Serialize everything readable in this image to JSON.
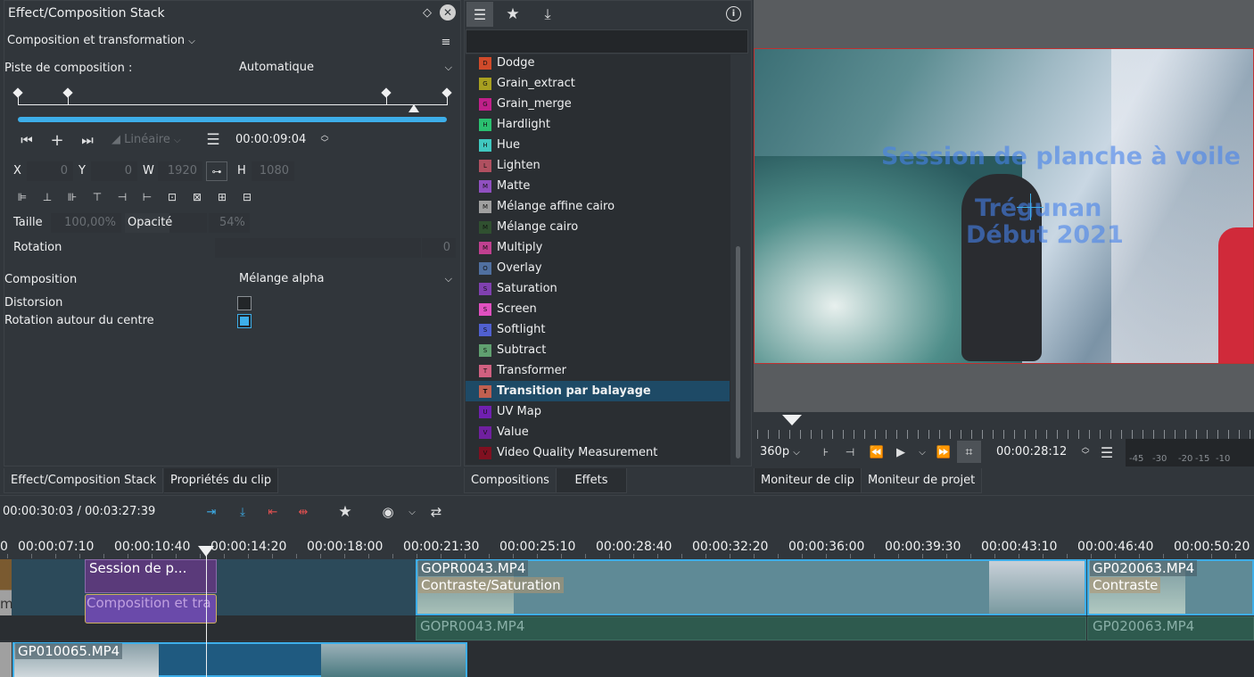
{
  "effect_panel": {
    "title": "Effect/Composition Stack",
    "section": "Composition et transformation",
    "track_label": "Piste de composition :",
    "track_value": "Automatique",
    "interp": "Linéaire",
    "timecode": "00:00:09:04",
    "x_label": "X",
    "x_value": "0",
    "y_label": "Y",
    "y_value": "0",
    "w_label": "W",
    "w_value": "1920",
    "h_label": "H",
    "h_value": "1080",
    "size_label": "Taille",
    "size_value": "100,00%",
    "opacity_label": "Opacité",
    "opacity_value": "54%",
    "rotation_label": "Rotation",
    "rotation_value": "0",
    "composition_label": "Composition",
    "composition_value": "Mélange alpha",
    "distortion_label": "Distorsion",
    "rotate_center_label": "Rotation autour du centre",
    "distortion_checked": false,
    "rotate_center_checked": true
  },
  "left_tabs": {
    "tab1": "Effect/Composition Stack",
    "tab2": "Propriétés du clip"
  },
  "compositions": {
    "items": [
      {
        "badge": "D",
        "label": "Dodge",
        "color": "#d04a2a"
      },
      {
        "badge": "G",
        "label": "Grain_extract",
        "color": "#a8a020"
      },
      {
        "badge": "G",
        "label": "Grain_merge",
        "color": "#c0208a"
      },
      {
        "badge": "H",
        "label": "Hardlight",
        "color": "#2ac070"
      },
      {
        "badge": "H",
        "label": "Hue",
        "color": "#40c8c0"
      },
      {
        "badge": "L",
        "label": "Lighten",
        "color": "#b05060"
      },
      {
        "badge": "M",
        "label": "Matte",
        "color": "#9050c0"
      },
      {
        "badge": "M",
        "label": "Mélange affine cairo",
        "color": "#a0a0a0"
      },
      {
        "badge": "M",
        "label": "Mélange cairo",
        "color": "#305030"
      },
      {
        "badge": "M",
        "label": "Multiply",
        "color": "#c04090"
      },
      {
        "badge": "O",
        "label": "Overlay",
        "color": "#5070a0"
      },
      {
        "badge": "S",
        "label": "Saturation",
        "color": "#8040b0"
      },
      {
        "badge": "S",
        "label": "Screen",
        "color": "#e050c0"
      },
      {
        "badge": "S",
        "label": "Softlight",
        "color": "#5060d0"
      },
      {
        "badge": "S",
        "label": "Subtract",
        "color": "#60a070"
      },
      {
        "badge": "T",
        "label": "Transformer",
        "color": "#d06080"
      },
      {
        "badge": "T",
        "label": "Transition par balayage",
        "color": "#c06050"
      },
      {
        "badge": "U",
        "label": "UV Map",
        "color": "#7020b0"
      },
      {
        "badge": "V",
        "label": "Value",
        "color": "#7020a0"
      },
      {
        "badge": "V",
        "label": "Video Quality Measurement",
        "color": "#801020"
      }
    ],
    "selected_index": 16
  },
  "middle_tabs": {
    "tab1": "Compositions",
    "tab2": "Effets"
  },
  "monitor": {
    "overlay_line1": "Session de planche à voile",
    "overlay_line2": "Trégunan",
    "overlay_line3": "Début 2021",
    "resolution": "360p",
    "timecode": "00:00:28:12",
    "meter_labels": [
      "-45",
      "-30",
      "-20",
      "-15",
      "-10"
    ]
  },
  "right_tabs": {
    "tab1": "Moniteur de clip",
    "tab2": "Moniteur de projet"
  },
  "timeline": {
    "position": "00:00:30:03 / 00:03:27:39",
    "ruler": [
      "00:00:07:10",
      "00:00:10:40",
      "00:00:14:20",
      "00:00:18:00",
      "00:00:21:30",
      "00:00:25:10",
      "00:00:28:40",
      "00:00:32:20",
      "00:00:36:00",
      "00:00:39:30",
      "00:00:43:10",
      "00:00:46:40",
      "00:00:50:20"
    ],
    "ruler_start": "0",
    "clip1_title": "Session de p...",
    "clip1_comp": "Composition et tra",
    "clip2_title": "GOPR0043.MP4",
    "clip2_effect": "Contraste/Saturation",
    "clip2_audio": "GOPR0043.MP4",
    "clip3_title": "GP020063.MP4",
    "clip3_effect": "Contraste",
    "clip3_audio": "GP020063.MP4",
    "clip4_title": "GP010065.MP4",
    "left_stub": "m"
  }
}
